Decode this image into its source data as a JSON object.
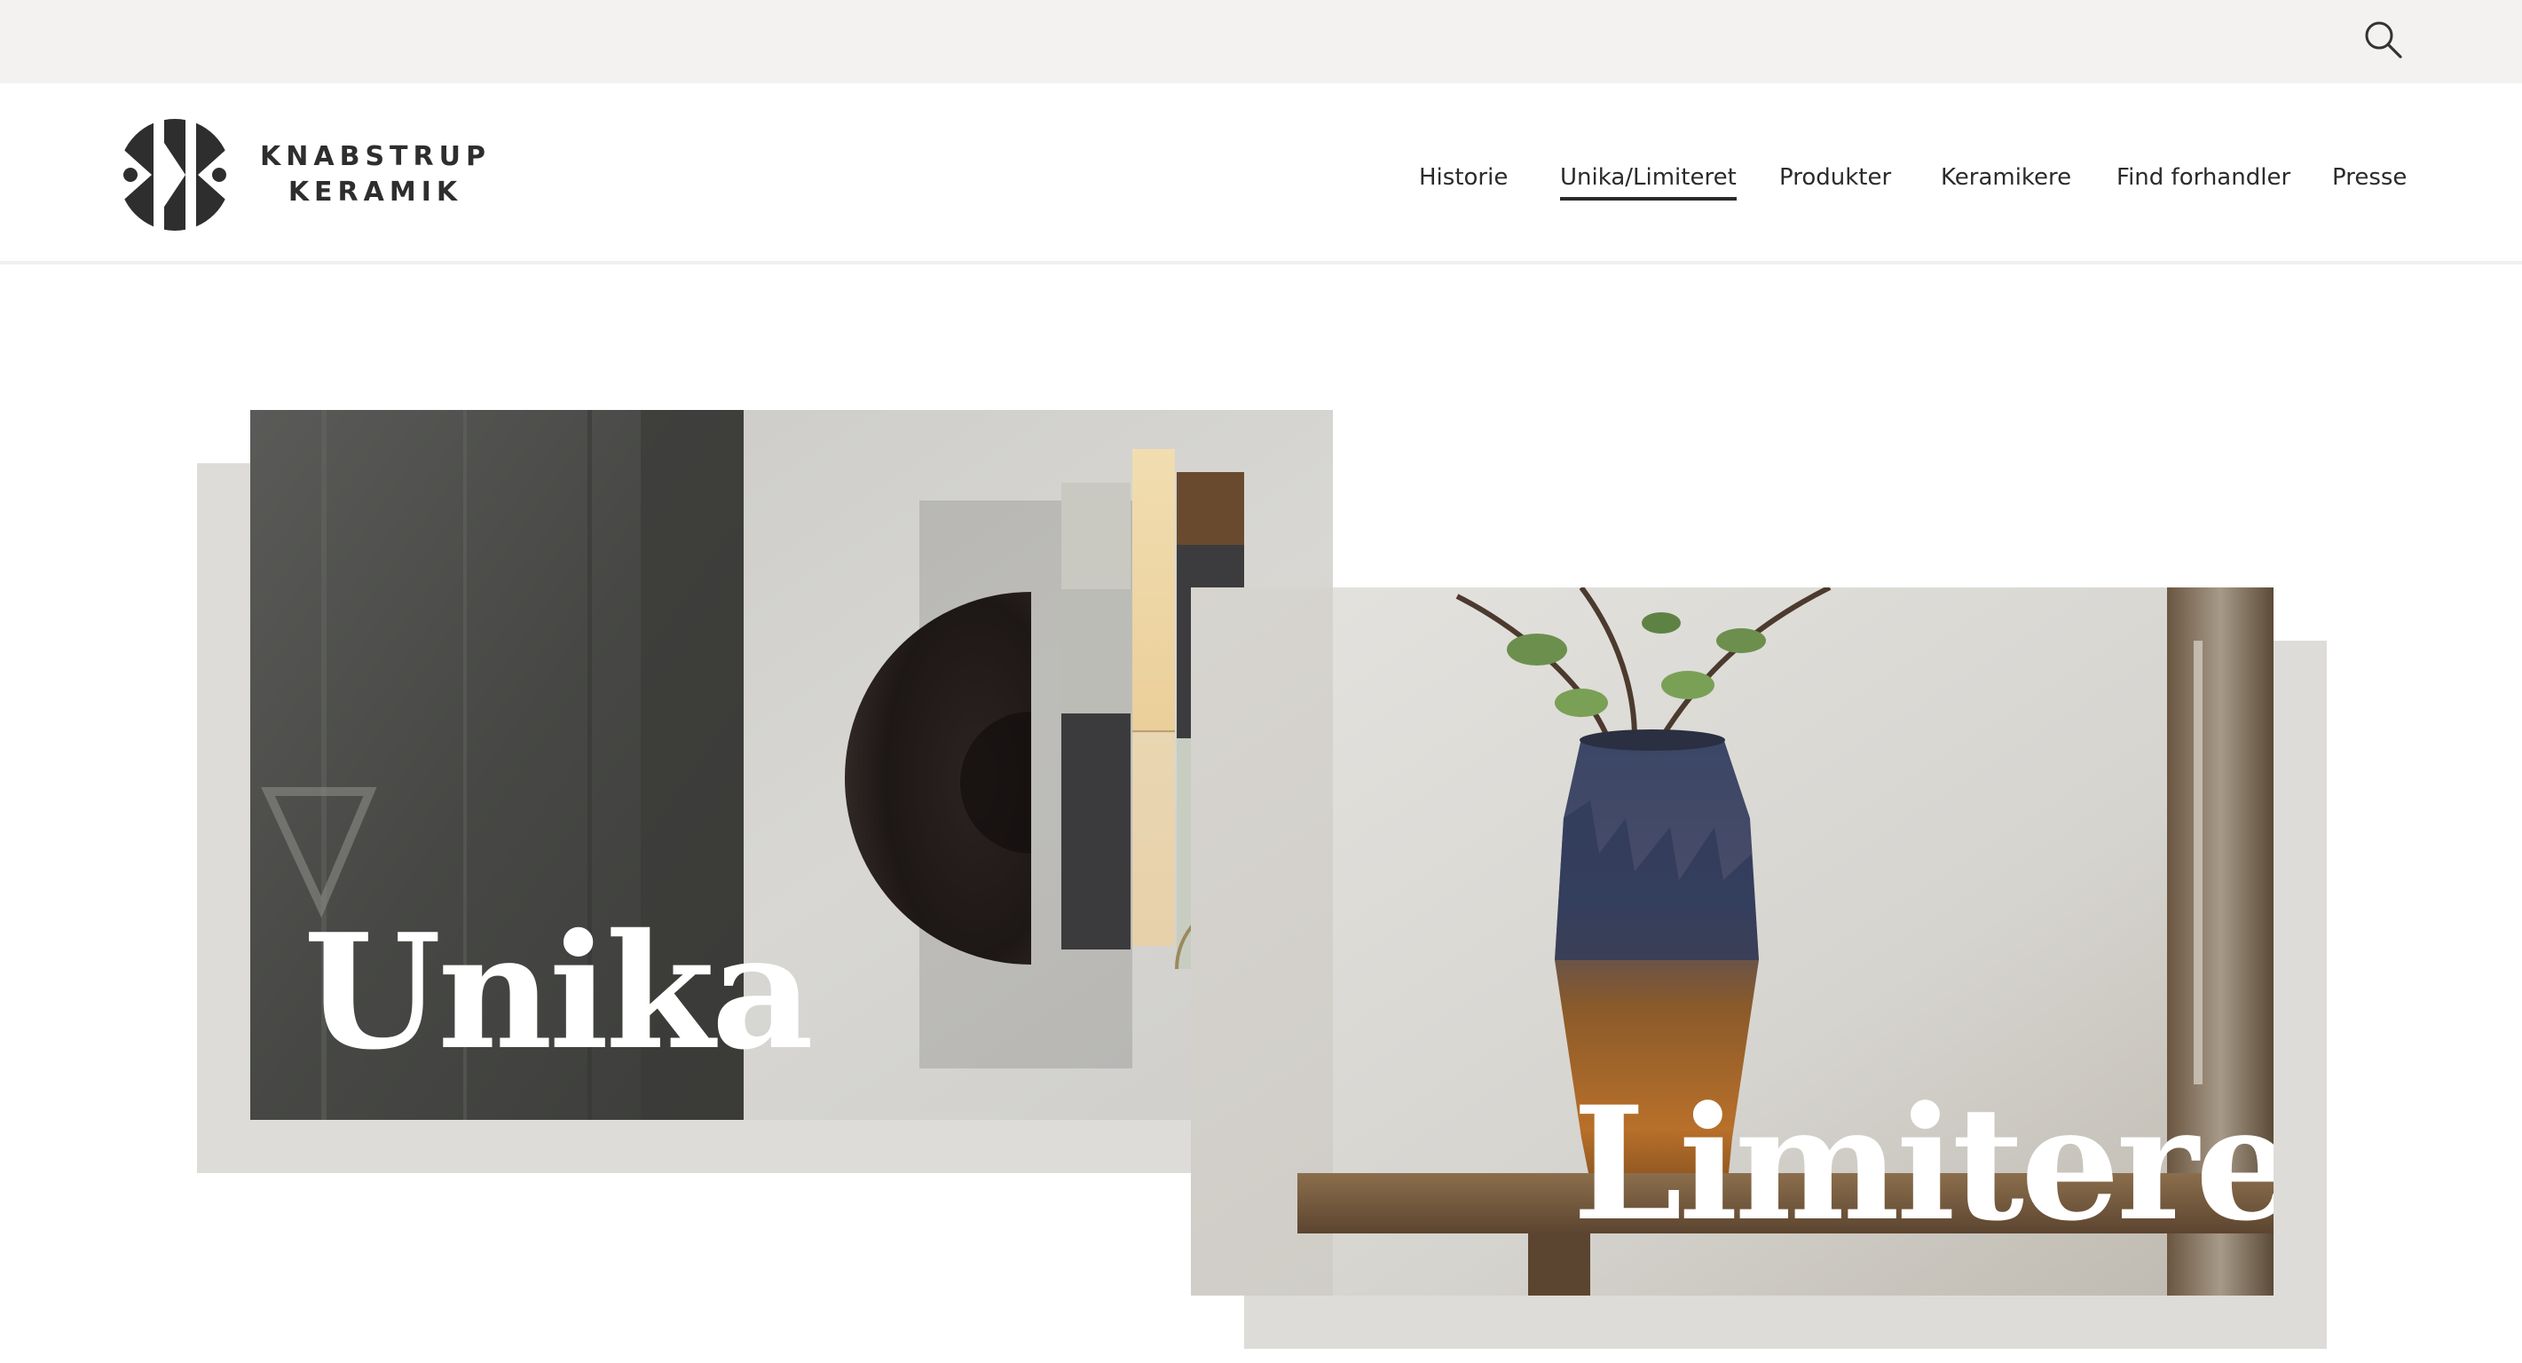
{
  "topbar": {
    "search_icon": "search-icon"
  },
  "brand": {
    "line1": "KNABSTRUP",
    "line2": "KERAMIK",
    "color": "#2e2e2e"
  },
  "nav": {
    "items": [
      {
        "label": "Historie",
        "active": false
      },
      {
        "label": "Unika/Limiteret",
        "active": true
      },
      {
        "label": "Produkter",
        "active": false
      },
      {
        "label": "Keramikere",
        "active": false
      },
      {
        "label": "Find forhandler",
        "active": false
      },
      {
        "label": "Presse",
        "active": false
      }
    ]
  },
  "cards": {
    "unika": {
      "title": "Unika"
    },
    "limiteret": {
      "title": "Limiteret"
    }
  },
  "colors": {
    "topbar_bg": "#f3f2f0",
    "shadow_block": "#dedcd8",
    "text": "#2b2b2b"
  }
}
